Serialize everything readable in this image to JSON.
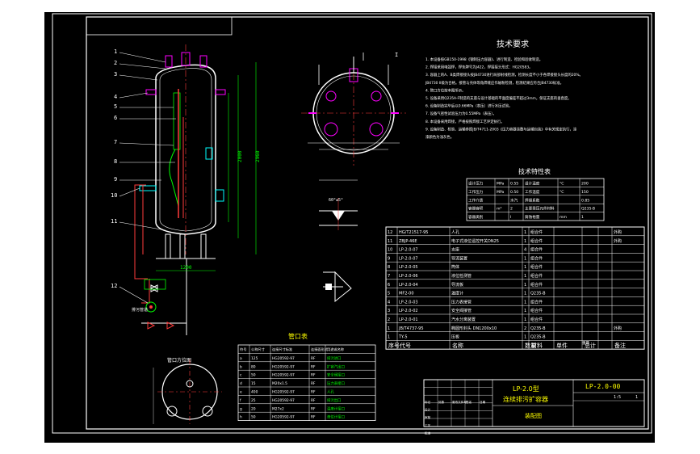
{
  "tech_requirements": {
    "title": "技术要求",
    "items": [
      "1. 本设备按GB150-1998《钢制压力容器》、进行制造、检验和验收制造。",
      "2. 焊接采用电弧焊，焊条牌号为J422，焊接接头形式：HG20583。",
      "3. 容器上的A、B类焊接接头按JB4730进行局部射线检测，检测长度不小于各焊接接头长度的20%。",
      "   JB4730 II级为合格。接管与壳体等角焊缝应作磁粉检测，检测结果应符合JB4730标准。",
      "4. 管口方位按本图所示。",
      "5. 设备采用Q235A-F制造的支座与设计基础的平面度偏差不超过3mm，保证支座的垂直度。",
      "6. 设备制造完毕后以0.66MPa（表压）进行水压试验。",
      "7. 设备气密性试验压力为0.55MPa（表压）。",
      "8. 本设备采用焊接，严格按照焊接工艺评定执行。",
      "9. 设备制造、检验、运输参照JB/T4711-2003《压力容器涂敷与运输包装》中有关规定执行，涂",
      "   漆颜色为浅灰色。"
    ]
  },
  "tech_table": {
    "title": "技术特性表",
    "rows": [
      [
        "设计压力",
        "MPa",
        "0.55",
        "设计温度",
        "°C",
        "200"
      ],
      [
        "工作压力",
        "MPa",
        "0.50",
        "工作温度",
        "°C",
        "150"
      ],
      [
        "工作介质",
        "",
        "水汽",
        "焊缝系数",
        "",
        "0.85"
      ],
      [
        "容器容积",
        "m³",
        "2",
        "主要受压元件材料",
        "",
        "Q235-B"
      ],
      [
        "容器类别",
        "",
        "I",
        "腐蚀裕量",
        "mm",
        "1"
      ]
    ]
  },
  "parts_list": {
    "rows": [
      [
        "12",
        "HG/T21517-95",
        "人孔",
        "1",
        "组合件",
        "",
        "",
        "外购"
      ],
      [
        "11",
        "ZBJP-46E",
        "电子式液位遥控开关DN25",
        "1",
        "组合件",
        "",
        "",
        "外购"
      ],
      [
        "10",
        "LP-2.0-07",
        "支座",
        "4",
        "组合件",
        "",
        "",
        ""
      ],
      [
        "9",
        "LP-2.0-07",
        "导流装置",
        "1",
        "组合件",
        "",
        "",
        ""
      ],
      [
        "8",
        "LP-2.0-05",
        "筒体",
        "1",
        "组合件",
        "",
        "",
        ""
      ],
      [
        "7",
        "LP-2.0-06",
        "液位检测管",
        "1",
        "组合件",
        "",
        "",
        ""
      ],
      [
        "6",
        "LP-2.0-04",
        "导流板",
        "1",
        "组合件",
        "",
        "",
        ""
      ],
      [
        "5",
        "MF2-00",
        "温度计",
        "1",
        "Q235-B",
        "",
        "",
        ""
      ],
      [
        "4",
        "LP-2.0-03",
        "压力表接管",
        "1",
        "组合件",
        "",
        "",
        ""
      ],
      [
        "3",
        "LP-2.0-02",
        "安全阀接管",
        "1",
        "组合件",
        "",
        "",
        ""
      ],
      [
        "2",
        "LP-2.0-01",
        "汽水分离装置",
        "1",
        "组合件",
        "",
        "",
        ""
      ],
      [
        "1",
        "JB/T4737-95",
        "椭圆形封头 DN1200x10",
        "2",
        "Q235-B",
        "",
        "",
        "外购"
      ],
      [
        "1",
        "TY-5",
        "压板",
        "1",
        "Q235-B",
        "",
        "",
        ""
      ]
    ],
    "header": [
      "序号",
      "代号",
      "名称",
      "数量",
      "材料",
      "单件",
      "总计",
      "备注"
    ],
    "weight_label": "重量"
  },
  "title_block": {
    "product": "LP-2.0型",
    "name": "连续排污扩容器",
    "drawing_no": "LP-2.0-00",
    "scale_hint": "装配图",
    "scale": "1:5",
    "sheet": "1",
    "grid_labels": [
      "标记",
      "处数",
      "更改文件号",
      "签名",
      "日期",
      "设计",
      "审核",
      "工艺",
      "批准"
    ]
  },
  "nozzle_table": {
    "title": "管口表",
    "header": [
      "符号",
      "公称尺寸",
      "连接尺寸标准",
      "连接面形式",
      "用途或名称"
    ],
    "rows": [
      [
        "a",
        "125",
        "HG20592-97",
        "RF",
        "排污进口"
      ],
      [
        "b",
        "80",
        "HG20592-97",
        "RF",
        "扩容汽出口"
      ],
      [
        "c",
        "50",
        "HG20592-97",
        "RF",
        "安全阀接口"
      ],
      [
        "d",
        "15",
        "M20x1.5",
        "RF",
        "压力表接口"
      ],
      [
        "e",
        "400",
        "HG20592-97",
        "RF",
        "人孔"
      ],
      [
        "f",
        "25",
        "HG20592-97",
        "RF",
        "排污出口"
      ],
      [
        "g",
        "20",
        "M27x2",
        "RF",
        "温度计接口"
      ],
      [
        "h",
        "50",
        "HG20592-97",
        "RF",
        "液位计接口"
      ]
    ]
  },
  "callouts": [
    "1",
    "2",
    "3",
    "4",
    "5",
    "6",
    "7",
    "8",
    "9",
    "10",
    "11",
    "12",
    "I"
  ],
  "labels": {
    "nozzle_layout": "管口方位图",
    "valve_note": "排污管道",
    "weld_dim": "60°±5°",
    "detail_mark": "I"
  },
  "dims": [
    "2960",
    "1200",
    "1290",
    "925",
    "2000",
    "390",
    "590",
    "400"
  ]
}
